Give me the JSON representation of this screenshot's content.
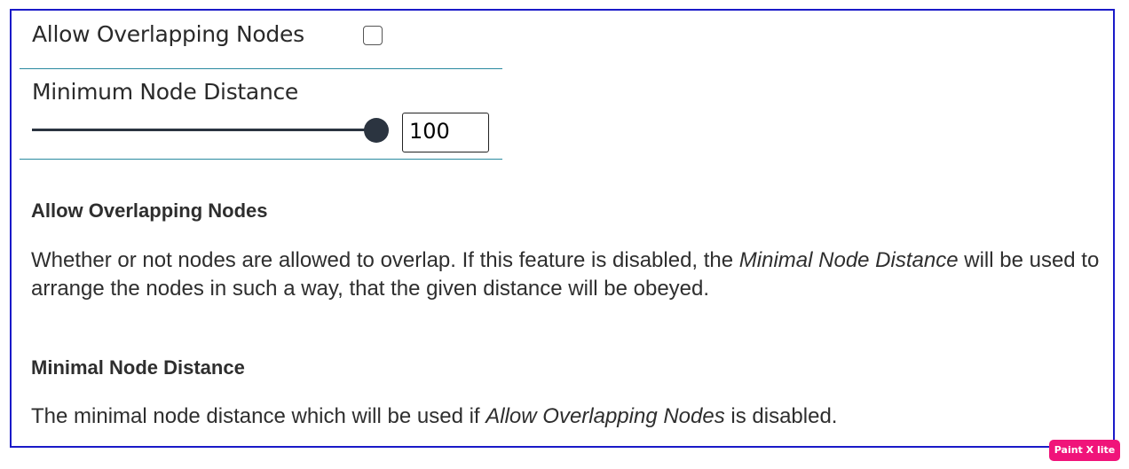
{
  "options": {
    "allow_overlapping": {
      "label": "Allow Overlapping Nodes",
      "checked": false
    },
    "minimum_distance": {
      "label": "Minimum Node Distance",
      "value": "100",
      "slider_level": 1.0
    }
  },
  "help": {
    "overlap": {
      "title": "Allow Overlapping Nodes",
      "text_before": "Whether or not nodes are allowed to overlap. If this feature is disabled, the ",
      "text_em": "Minimal Node Distance",
      "text_after": " will be used to arrange the nodes in such a way, that the given distance will be obeyed."
    },
    "distance": {
      "title": "Minimal Node Distance",
      "text_before": "The minimal node distance which will be used if ",
      "text_em": "Allow Overlapping Nodes",
      "text_after": " is disabled."
    }
  },
  "watermark": "Paint X lite",
  "colors": {
    "frame_border": "#1a1ac8",
    "divider": "#2a8aa0",
    "slider": "#2b3440",
    "watermark_bg": "#f0147a"
  }
}
